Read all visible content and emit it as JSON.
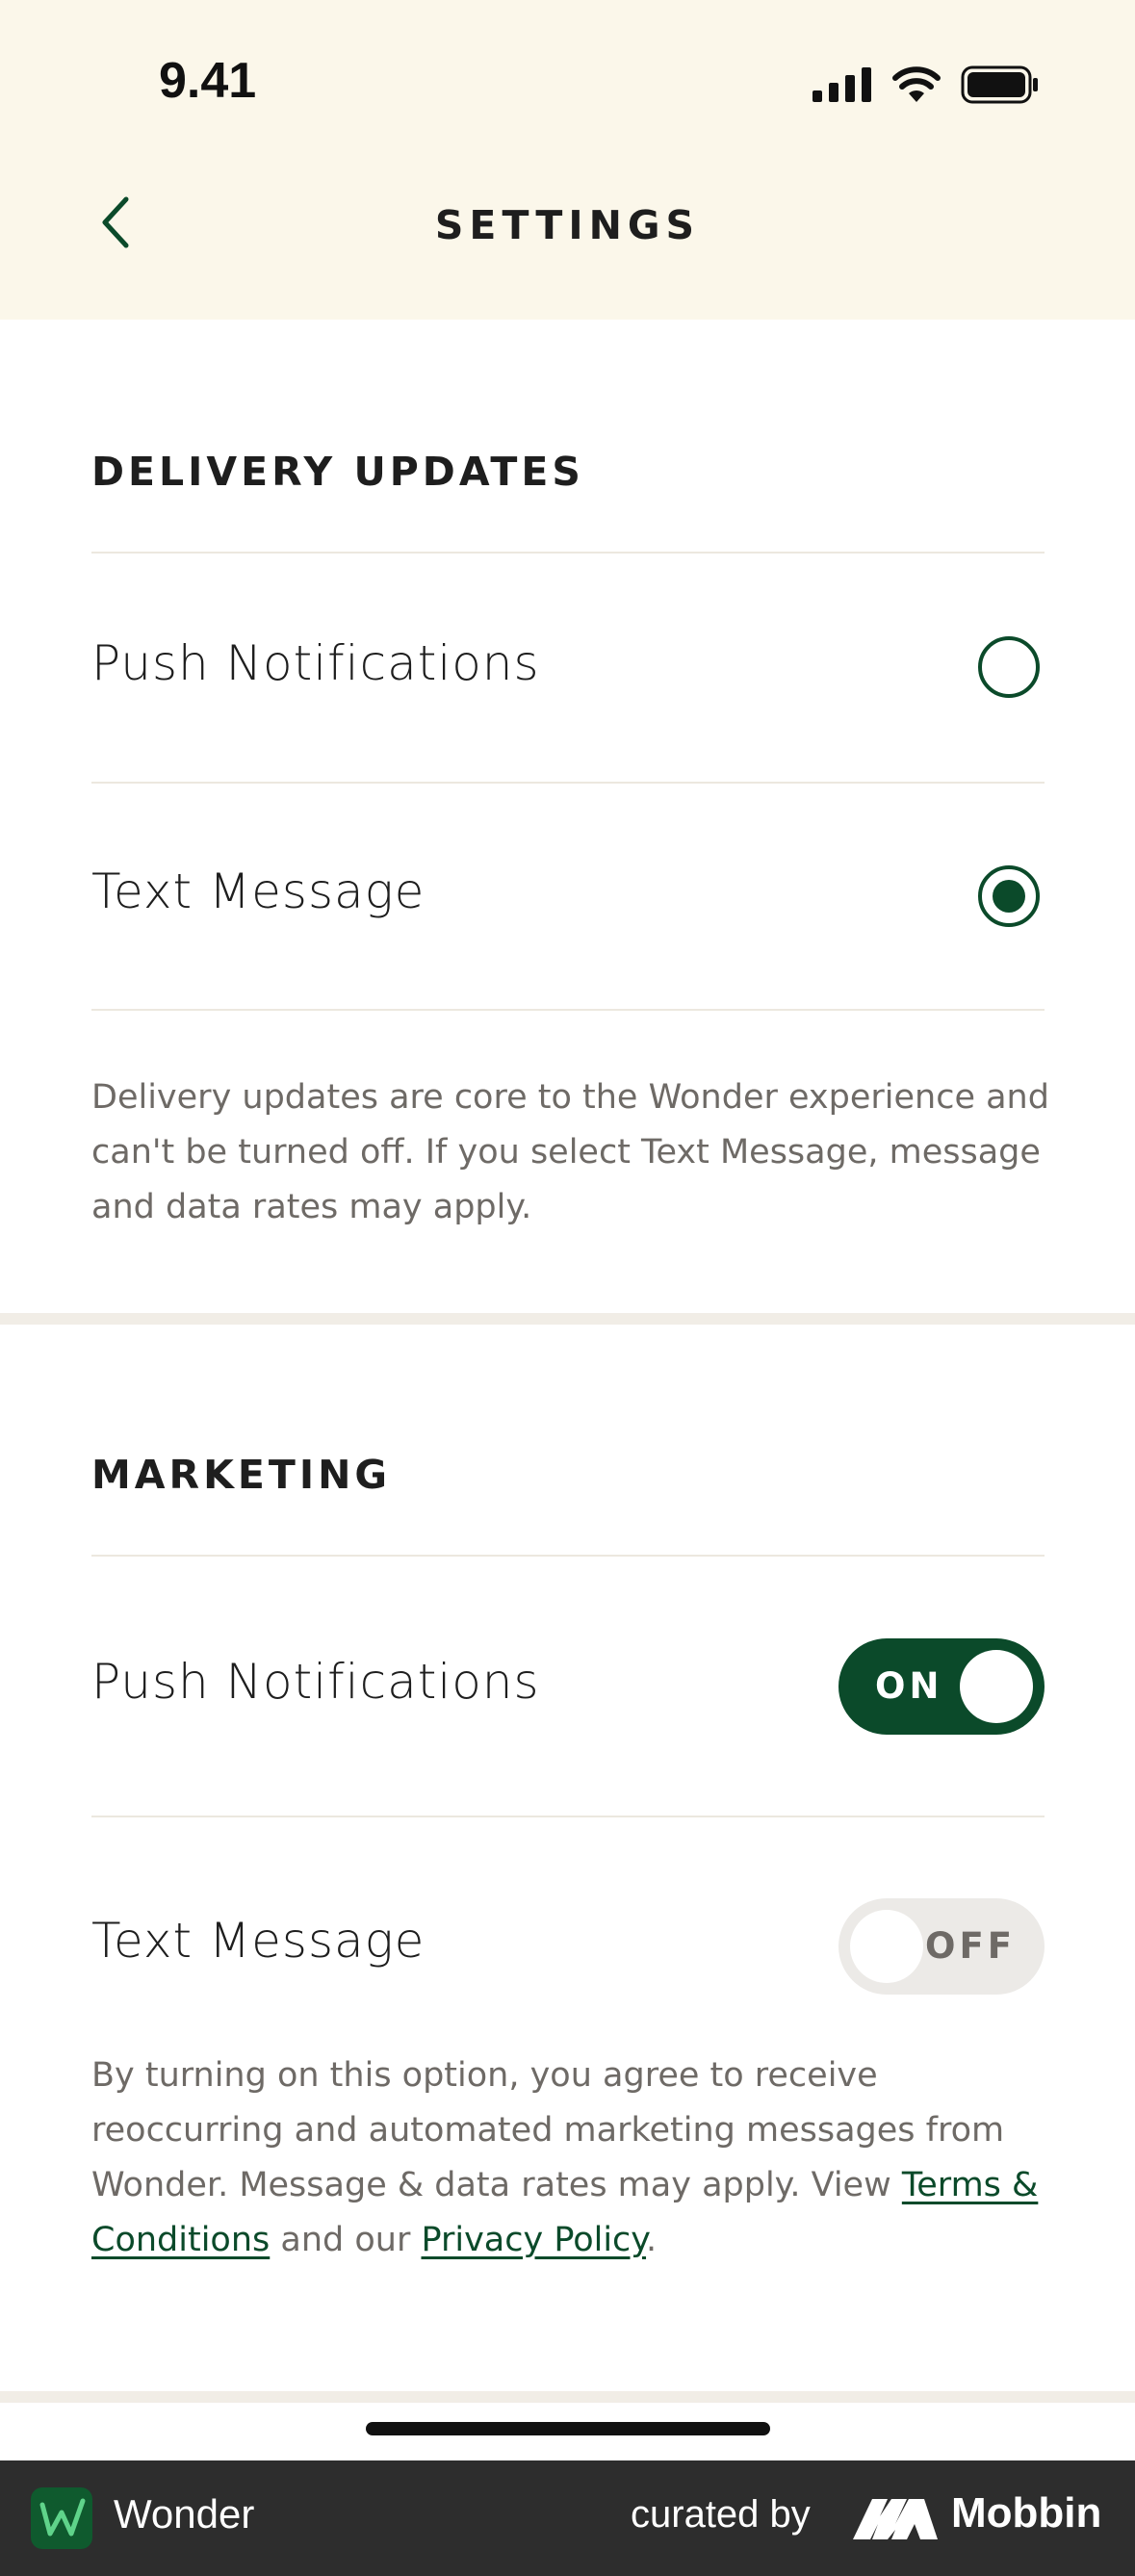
{
  "status_bar": {
    "time": "9.41",
    "icons": [
      "signal-icon",
      "wifi-icon",
      "battery-icon"
    ]
  },
  "header": {
    "title": "SETTINGS",
    "back_icon": "chevron-left-icon"
  },
  "delivery_updates": {
    "heading": "DELIVERY UPDATES",
    "options": [
      {
        "label": "Push Notifications",
        "selected": false
      },
      {
        "label": "Text Message",
        "selected": true
      }
    ],
    "helper_text": "Delivery updates are core to the Wonder experience and can't be turned off. If you select Text Message, message and data rates may apply."
  },
  "marketing": {
    "heading": "MARKETING",
    "push_notifications": {
      "label": "Push Notifications",
      "state": "ON"
    },
    "text_message": {
      "label": "Text Message",
      "state": "OFF"
    },
    "helper_text_before": "By turning on this option, you agree to receive reoccurring and automated marketing messages from Wonder. Message & data rates may apply. View ",
    "terms_link": "Terms & Conditions",
    "helper_text_middle": " and our ",
    "privacy_link": "Privacy Policy",
    "helper_text_after": "."
  },
  "footer": {
    "app_name": "Wonder",
    "curated_by": "curated by",
    "brand": "Mobbin"
  },
  "colors": {
    "accent": "#0b4a2a",
    "header_bg": "#fbf7ea",
    "footer_bg": "#2d2d2d",
    "muted_text": "#6e6a66"
  }
}
